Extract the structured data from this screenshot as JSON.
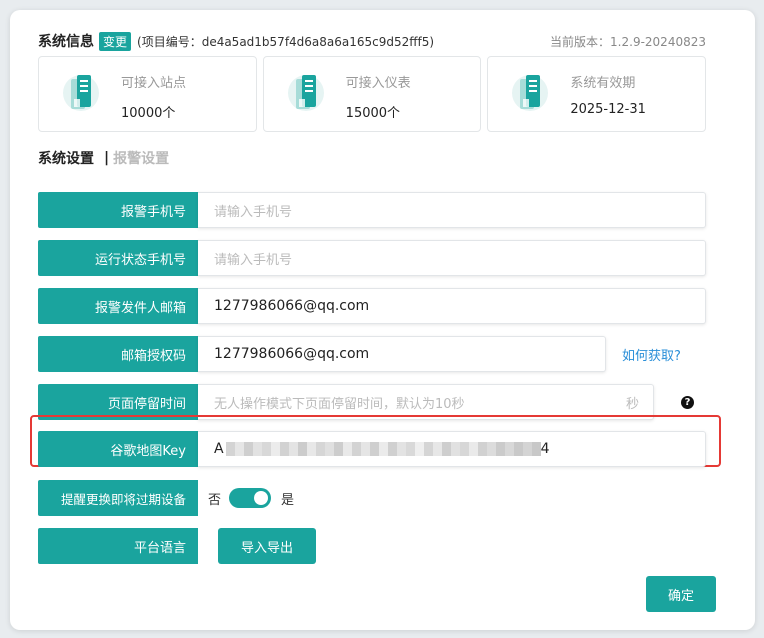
{
  "header": {
    "title": "系统信息",
    "change_label": "变更",
    "project_no": "(项目编号：de4a5ad1b57f4d6a8a6a165c9d52fff5)",
    "version": "当前版本：1.2.9-20240823"
  },
  "cards": [
    {
      "label": "可接入站点",
      "value": "10000个",
      "icon": "server-icon"
    },
    {
      "label": "可接入仪表",
      "value": "15000个",
      "icon": "server-icon"
    },
    {
      "label": "系统有效期",
      "value": "2025-12-31",
      "icon": "server-icon"
    }
  ],
  "tabs": {
    "active": "系统设置",
    "separator": "|",
    "inactive": "报警设置"
  },
  "form": {
    "alarm_phone": {
      "label": "报警手机号",
      "placeholder": "请输入手机号"
    },
    "status_phone": {
      "label": "运行状态手机号",
      "placeholder": "请输入手机号"
    },
    "sender_email": {
      "label": "报警发件人邮箱",
      "value": "1277986066@qq.com"
    },
    "email_auth": {
      "label": "邮箱授权码",
      "value": "1277986066@qq.com",
      "link": "如何获取?"
    },
    "page_stay": {
      "label": "页面停留时间",
      "placeholder": "无人操作模式下页面停留时间，默认为10秒",
      "suffix": "秒",
      "help": "?"
    },
    "google_key": {
      "label": "谷歌地图Key",
      "prefix": "A",
      "suffix": "4"
    },
    "remind_replace": {
      "label": "提醒更换即将过期设备",
      "off_label": "否",
      "on_label": "是",
      "enabled": true
    },
    "language": {
      "label": "平台语言",
      "button": "导入导出"
    }
  },
  "confirm_button": "确定",
  "colors": {
    "accent": "#1aa49e",
    "link": "#2a8fd8",
    "highlight": "#e53935"
  }
}
